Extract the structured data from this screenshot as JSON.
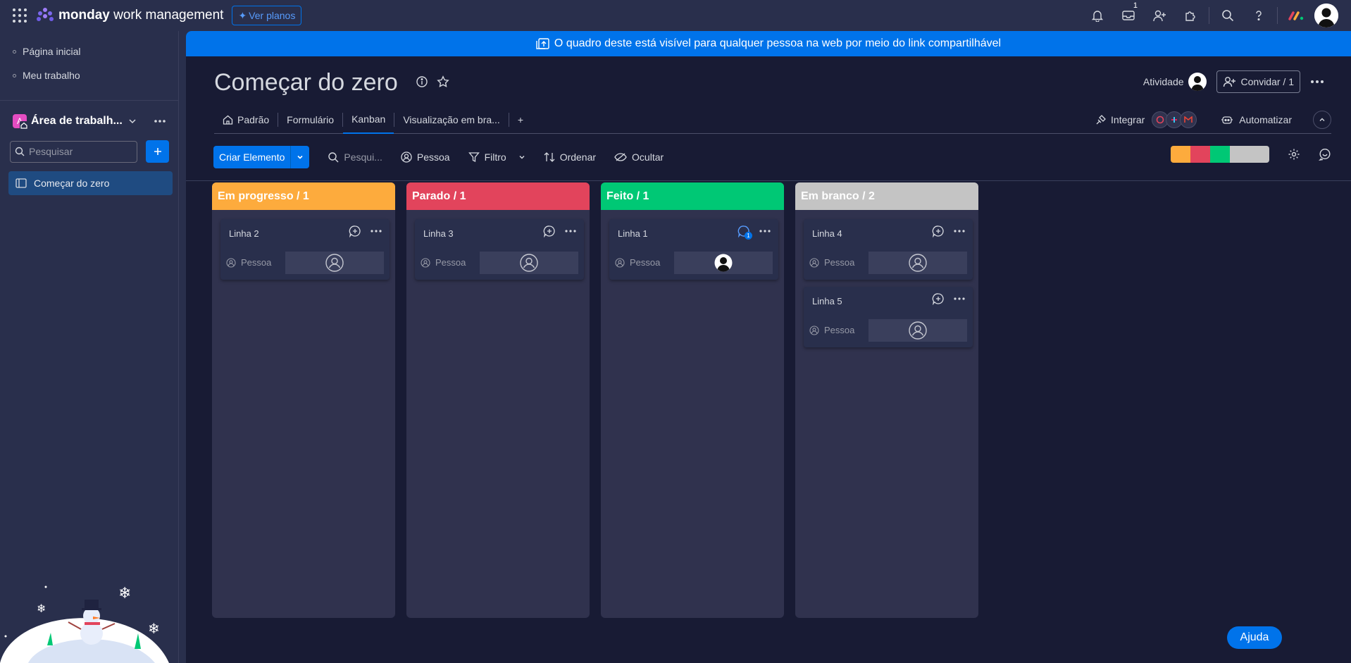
{
  "topbar": {
    "brand_bold": "monday",
    "brand_rest": " work management",
    "plans_label": "Ver planos",
    "inbox_badge": "1"
  },
  "sidebar": {
    "nav": [
      {
        "label": "Página inicial"
      },
      {
        "label": "Meu trabalho"
      }
    ],
    "workspace": {
      "badge": "A",
      "name": "Área de trabalh..."
    },
    "search_placeholder": "Pesquisar",
    "boards": [
      {
        "label": "Começar do zero"
      }
    ]
  },
  "banner": {
    "text": "O quadro deste está visível para qualquer pessoa na web por meio do link compartilhável"
  },
  "board": {
    "title": "Começar do zero",
    "activity_label": "Atividade",
    "invite_label": "Convidar / 1",
    "tabs": [
      {
        "label": "Padrão"
      },
      {
        "label": "Formulário"
      },
      {
        "label": "Kanban"
      },
      {
        "label": "Visualização em bra..."
      }
    ],
    "add_tab": "+",
    "integrate_label": "Integrar",
    "automate_label": "Automatizar"
  },
  "toolbar": {
    "create_label": "Criar Elemento",
    "search_placeholder": "Pesqui...",
    "person_label": "Pessoa",
    "filter_label": "Filtro",
    "sort_label": "Ordenar",
    "hide_label": "Ocultar",
    "status_colors": [
      "#fdab3d",
      "#e2445c",
      "#00c875",
      "#c4c4c4"
    ]
  },
  "kanban": {
    "columns": [
      {
        "title": "Em progresso / 1",
        "color": "#fdab3d",
        "cards": [
          {
            "name": "Linha 2",
            "person_label": "Pessoa"
          }
        ]
      },
      {
        "title": "Parado / 1",
        "color": "#e2445c",
        "cards": [
          {
            "name": "Linha 3",
            "person_label": "Pessoa"
          }
        ]
      },
      {
        "title": "Feito / 1",
        "color": "#00c875",
        "cards": [
          {
            "name": "Linha 1",
            "person_label": "Pessoa",
            "updates": "1"
          }
        ]
      },
      {
        "title": "Em branco / 2",
        "color": "#c4c4c4",
        "cards": [
          {
            "name": "Linha 4",
            "person_label": "Pessoa"
          },
          {
            "name": "Linha 5",
            "person_label": "Pessoa"
          }
        ]
      }
    ]
  },
  "help_label": "Ajuda"
}
